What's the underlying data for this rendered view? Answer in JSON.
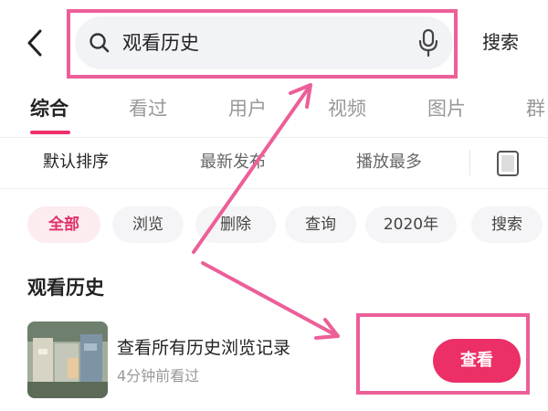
{
  "header": {
    "search_text": "观看历史",
    "search_button": "搜索"
  },
  "tabs": [
    {
      "label": "综合",
      "active": true
    },
    {
      "label": "看过",
      "active": false
    },
    {
      "label": "用户",
      "active": false
    },
    {
      "label": "视频",
      "active": false
    },
    {
      "label": "图片",
      "active": false
    },
    {
      "label": "群",
      "active": false
    }
  ],
  "sort_options": [
    {
      "label": "默认排序",
      "active": true
    },
    {
      "label": "最新发布",
      "active": false
    },
    {
      "label": "播放最多",
      "active": false
    }
  ],
  "chips": [
    {
      "label": "全部",
      "active": true
    },
    {
      "label": "浏览",
      "active": false
    },
    {
      "label": "删除",
      "active": false
    },
    {
      "label": "查询",
      "active": false
    },
    {
      "label": "2020年",
      "active": false
    },
    {
      "label": "搜索",
      "active": false
    }
  ],
  "section": {
    "title": "观看历史",
    "item": {
      "title": "查看所有历史浏览记录",
      "subtitle": "4分钟前看过",
      "action_label": "查看"
    }
  },
  "colors": {
    "accent": "#ec2f66",
    "highlight": "#ec5f98",
    "chip_active_bg": "#fdecef"
  },
  "icons": [
    "back-arrow-icon",
    "search-icon",
    "microphone-icon",
    "layout-toggle-icon"
  ]
}
